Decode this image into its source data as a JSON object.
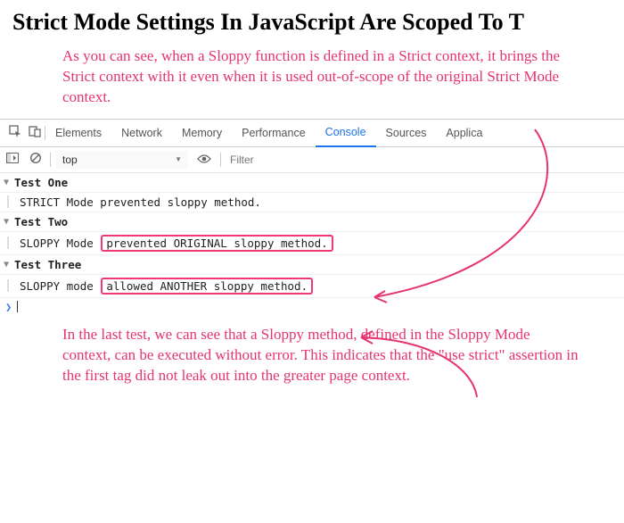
{
  "title": "Strict Mode Settings In JavaScript Are Scoped To T",
  "annotation_top": "As you can see, when a Sloppy function is defined in a Strict context, it brings the Strict context with it even when it is used out-of-scope of the original Strict Mode context.",
  "annotation_bottom": "In the last test, we can see that a Sloppy method, defined in the Sloppy Mode context, can be executed without error. This indicates that the \"use strict\" assertion in the first tag did not leak out into the greater page context.",
  "devtools": {
    "tabs": [
      "Elements",
      "Network",
      "Memory",
      "Performance",
      "Console",
      "Sources",
      "Applica"
    ],
    "active_tab": "Console",
    "context": "top",
    "filter_placeholder": "Filter"
  },
  "console": {
    "groups": [
      {
        "header": "Test One",
        "lines": [
          {
            "prefix": "STRICT Mode prevented sloppy method.",
            "boxed": ""
          }
        ]
      },
      {
        "header": "Test Two",
        "lines": [
          {
            "prefix": "SLOPPY Mode",
            "boxed": "prevented ORIGINAL sloppy method."
          }
        ]
      },
      {
        "header": "Test Three",
        "lines": [
          {
            "prefix": "SLOPPY mode",
            "boxed": "allowed ANOTHER sloppy method."
          }
        ]
      }
    ]
  }
}
